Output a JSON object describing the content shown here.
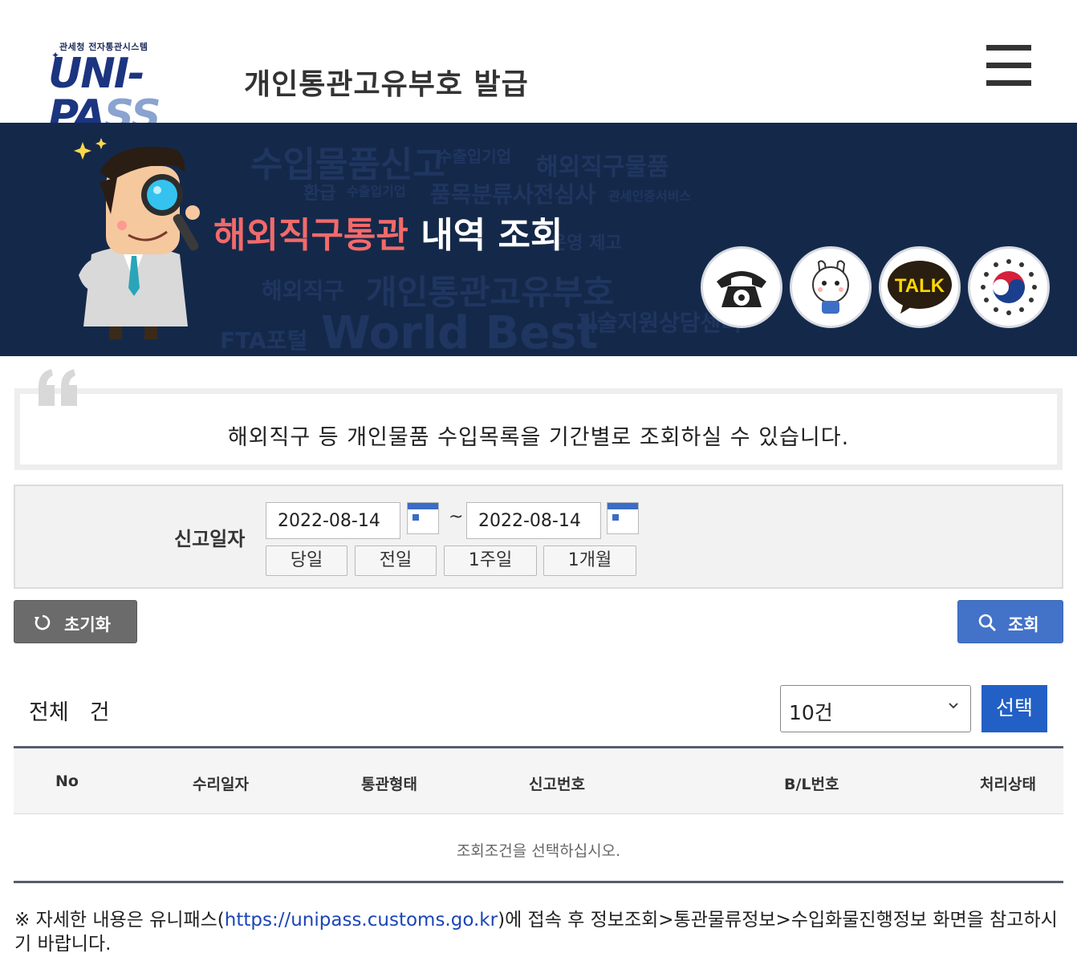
{
  "header": {
    "logo_small": "관세청 전자통관시스템",
    "logo_main_a": "UNI-PA",
    "logo_main_b": "SS",
    "title": "개인통관고유부호 발급",
    "menu_icon": "hamburger-menu-icon"
  },
  "banner": {
    "title_highlight": "해외직구통관",
    "title_rest": " 내역 조회",
    "bg_words": [
      "수입물품신고",
      "수출입기업",
      "해외직구물품",
      "환급",
      "수출입기업",
      "품목분류사전심사",
      "관세인증서비스",
      "개인통관고유부호",
      "해외직구",
      "FTA포털",
      "World Best",
      "기술지원상담센터",
      "운영 제고"
    ],
    "quick_links": [
      {
        "name": "phone-icon",
        "label": "phone"
      },
      {
        "name": "mascot-icon",
        "label": "mascot"
      },
      {
        "name": "kakao-talk-icon",
        "label": "TALK"
      },
      {
        "name": "government-emblem-icon",
        "label": "gov"
      }
    ]
  },
  "info": {
    "text": "해외직구 등 개인물품 수입목록을 기간별로 조회하실 수 있습니다."
  },
  "search": {
    "date_label": "신고일자",
    "start_date": "2022-08-14",
    "end_date": "2022-08-14",
    "separator": "~",
    "periods": [
      "당일",
      "전일",
      "1주일",
      "1개월"
    ]
  },
  "actions": {
    "reset_label": "초기화",
    "search_label": "조회"
  },
  "results": {
    "total_label": "전체",
    "count_unit": "건",
    "page_size": "10건",
    "select_label": "선택",
    "columns": [
      "No",
      "수리일자",
      "통관형태",
      "신고번호",
      "B/L번호",
      "처리상태"
    ],
    "empty_message": "조회조건을 선택하십시오."
  },
  "footnote": {
    "prefix": "※ 자세한 내용은 유니패스(",
    "link": "https://unipass.customs.go.kr",
    "suffix": ")에 접속 후 정보조회>통관물류정보>수입화물진행정보 화면을 참고하시기 바랍니다."
  },
  "colors": {
    "banner_bg": "#14294a",
    "highlight": "#f26a6a",
    "primary_button": "#4372c9",
    "select_button": "#2260c5",
    "reset_button": "#6b6b6b"
  }
}
